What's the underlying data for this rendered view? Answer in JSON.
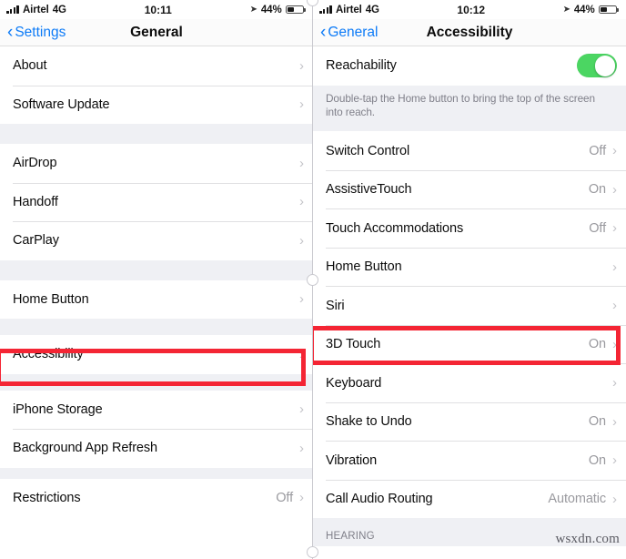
{
  "left": {
    "status": {
      "carrier": "Airtel",
      "network": "4G",
      "time": "10:11",
      "battery": "44%",
      "location_icon": "location-arrow-icon"
    },
    "nav": {
      "back_label": "Settings",
      "title": "General"
    },
    "groups": [
      {
        "rows": [
          {
            "label": "About",
            "value": "",
            "chevron": true
          },
          {
            "label": "Software Update",
            "value": "",
            "chevron": true
          }
        ]
      },
      {
        "rows": [
          {
            "label": "AirDrop",
            "value": "",
            "chevron": true
          },
          {
            "label": "Handoff",
            "value": "",
            "chevron": true
          },
          {
            "label": "CarPlay",
            "value": "",
            "chevron": true
          }
        ]
      },
      {
        "rows": [
          {
            "label": "Home Button",
            "value": "",
            "chevron": true
          }
        ]
      },
      {
        "rows": [
          {
            "label": "Accessibility",
            "value": "",
            "chevron": true,
            "highlighted": true
          }
        ]
      },
      {
        "rows": [
          {
            "label": "iPhone Storage",
            "value": "",
            "chevron": true
          },
          {
            "label": "Background App Refresh",
            "value": "",
            "chevron": true
          }
        ]
      },
      {
        "rows": [
          {
            "label": "Restrictions",
            "value": "Off",
            "chevron": true
          }
        ]
      }
    ]
  },
  "right": {
    "status": {
      "carrier": "Airtel",
      "network": "4G",
      "time": "10:12",
      "battery": "44%",
      "location_icon": "location-arrow-icon"
    },
    "nav": {
      "back_label": "General",
      "title": "Accessibility"
    },
    "reachability": {
      "label": "Reachability",
      "toggle_on": true,
      "toggle_color": "#4bd662"
    },
    "reachability_note": "Double-tap the Home button to bring the top of the screen into reach.",
    "rows": [
      {
        "label": "Switch Control",
        "value": "Off",
        "chevron": true
      },
      {
        "label": "AssistiveTouch",
        "value": "On",
        "chevron": true
      },
      {
        "label": "Touch Accommodations",
        "value": "Off",
        "chevron": true
      },
      {
        "label": "Home Button",
        "value": "",
        "chevron": true
      },
      {
        "label": "Siri",
        "value": "",
        "chevron": true
      },
      {
        "label": "3D Touch",
        "value": "On",
        "chevron": true,
        "highlighted": true
      },
      {
        "label": "Keyboard",
        "value": "",
        "chevron": true
      },
      {
        "label": "Shake to Undo",
        "value": "On",
        "chevron": true
      },
      {
        "label": "Vibration",
        "value": "On",
        "chevron": true
      },
      {
        "label": "Call Audio Routing",
        "value": "Automatic",
        "chevron": true
      }
    ],
    "section_header": "HEARING"
  },
  "highlight_color": "#f42534",
  "watermark": "wsxdn.com"
}
